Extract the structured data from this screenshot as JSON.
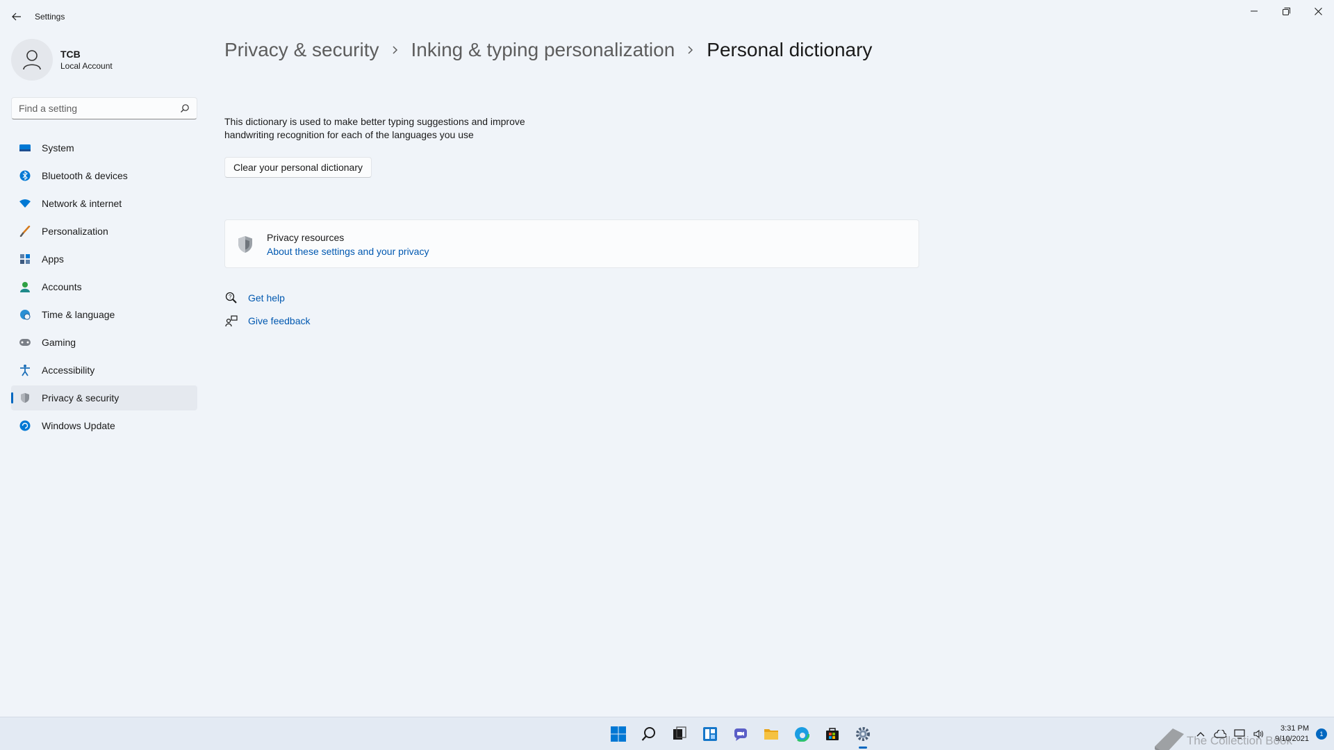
{
  "window": {
    "title": "Settings"
  },
  "profile": {
    "name": "TCB",
    "account_type": "Local Account"
  },
  "search": {
    "placeholder": "Find a setting"
  },
  "sidebar": {
    "items": [
      {
        "label": "System",
        "icon": "system-icon"
      },
      {
        "label": "Bluetooth & devices",
        "icon": "bluetooth-icon"
      },
      {
        "label": "Network & internet",
        "icon": "wifi-icon"
      },
      {
        "label": "Personalization",
        "icon": "brush-icon"
      },
      {
        "label": "Apps",
        "icon": "apps-icon"
      },
      {
        "label": "Accounts",
        "icon": "accounts-icon"
      },
      {
        "label": "Time & language",
        "icon": "globe-clock-icon"
      },
      {
        "label": "Gaming",
        "icon": "gamepad-icon"
      },
      {
        "label": "Accessibility",
        "icon": "accessibility-icon"
      },
      {
        "label": "Privacy & security",
        "icon": "shield-icon",
        "selected": true
      },
      {
        "label": "Windows Update",
        "icon": "update-icon"
      }
    ]
  },
  "breadcrumb": {
    "level1": "Privacy & security",
    "level2": "Inking & typing personalization",
    "current": "Personal dictionary"
  },
  "main": {
    "description": "This dictionary is used to make better typing suggestions and improve handwriting recognition for each of the languages you use",
    "clear_button": "Clear your personal dictionary",
    "privacy_card": {
      "title": "Privacy resources",
      "link": "About these settings and your privacy"
    },
    "help": {
      "get_help": "Get help",
      "give_feedback": "Give feedback"
    }
  },
  "taskbar": {
    "apps": [
      "start-icon",
      "search-icon",
      "task-view-icon",
      "widgets-icon",
      "chat-icon",
      "file-explorer-icon",
      "edge-icon",
      "store-icon",
      "settings-icon"
    ],
    "active_app": "settings-icon",
    "clock_time": "3:31 PM",
    "clock_date": "9/10/2021",
    "notification_count": "1"
  },
  "watermark": "The Collection Book",
  "colors": {
    "accent": "#0067c0",
    "link": "#0058b0",
    "background": "#f0f4f9"
  }
}
